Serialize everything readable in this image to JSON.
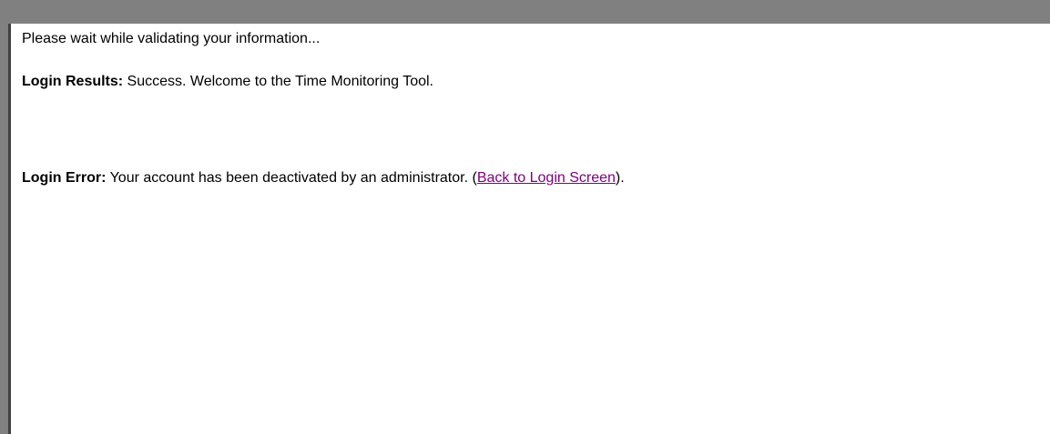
{
  "status_message": "Please wait while validating your information...",
  "login_results": {
    "label": "Login Results:",
    "text": " Success. Welcome to the Time Monitoring Tool."
  },
  "login_error": {
    "label": "Login Error:",
    "text_before_link": " Your account has been deactivated by an administrator. (",
    "link_label": "Back to Login Screen",
    "text_after_link": ")."
  },
  "colors": {
    "frame_border": "#808080",
    "link_visited": "#800080",
    "text": "#000000",
    "background": "#ffffff"
  }
}
